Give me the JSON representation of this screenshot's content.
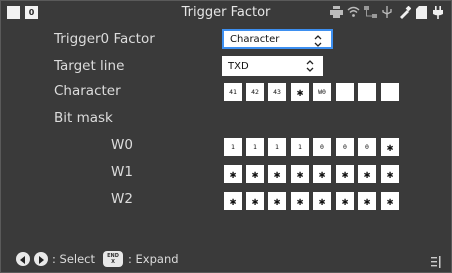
{
  "window": {
    "title": "Trigger Factor",
    "badge": "0"
  },
  "status_icons": [
    "printer-icon",
    "wifi-icon",
    "network-icon",
    "usb-icon",
    "probe-icon",
    "sd-card-icon",
    "power-plug-icon"
  ],
  "form": {
    "trigger_label": "Trigger0  Factor",
    "trigger_value": "Character",
    "target_label": "Target line",
    "target_value": "TXD",
    "character_label": "Character",
    "character_cells": [
      "41",
      "42",
      "43",
      "✱",
      "W0",
      "",
      "",
      ""
    ],
    "bitmask_label": "Bit mask",
    "rows": [
      {
        "label": "W0",
        "cells": [
          "1",
          "1",
          "1",
          "1",
          "0",
          "0",
          "0",
          "✱"
        ]
      },
      {
        "label": "W1",
        "cells": [
          "✱",
          "✱",
          "✱",
          "✱",
          "✱",
          "✱",
          "✱",
          "✱"
        ]
      },
      {
        "label": "W2",
        "cells": [
          "✱",
          "✱",
          "✱",
          "✱",
          "✱",
          "✱",
          "✱",
          "✱"
        ]
      }
    ]
  },
  "footer": {
    "select_text": ": Select",
    "end_key": "END",
    "end_key_sub": "X",
    "expand_text": ": Expand"
  },
  "colors": {
    "background": "#3a3a3a",
    "accent_focus": "#3d8ff0",
    "text": "#dcdcdc"
  }
}
